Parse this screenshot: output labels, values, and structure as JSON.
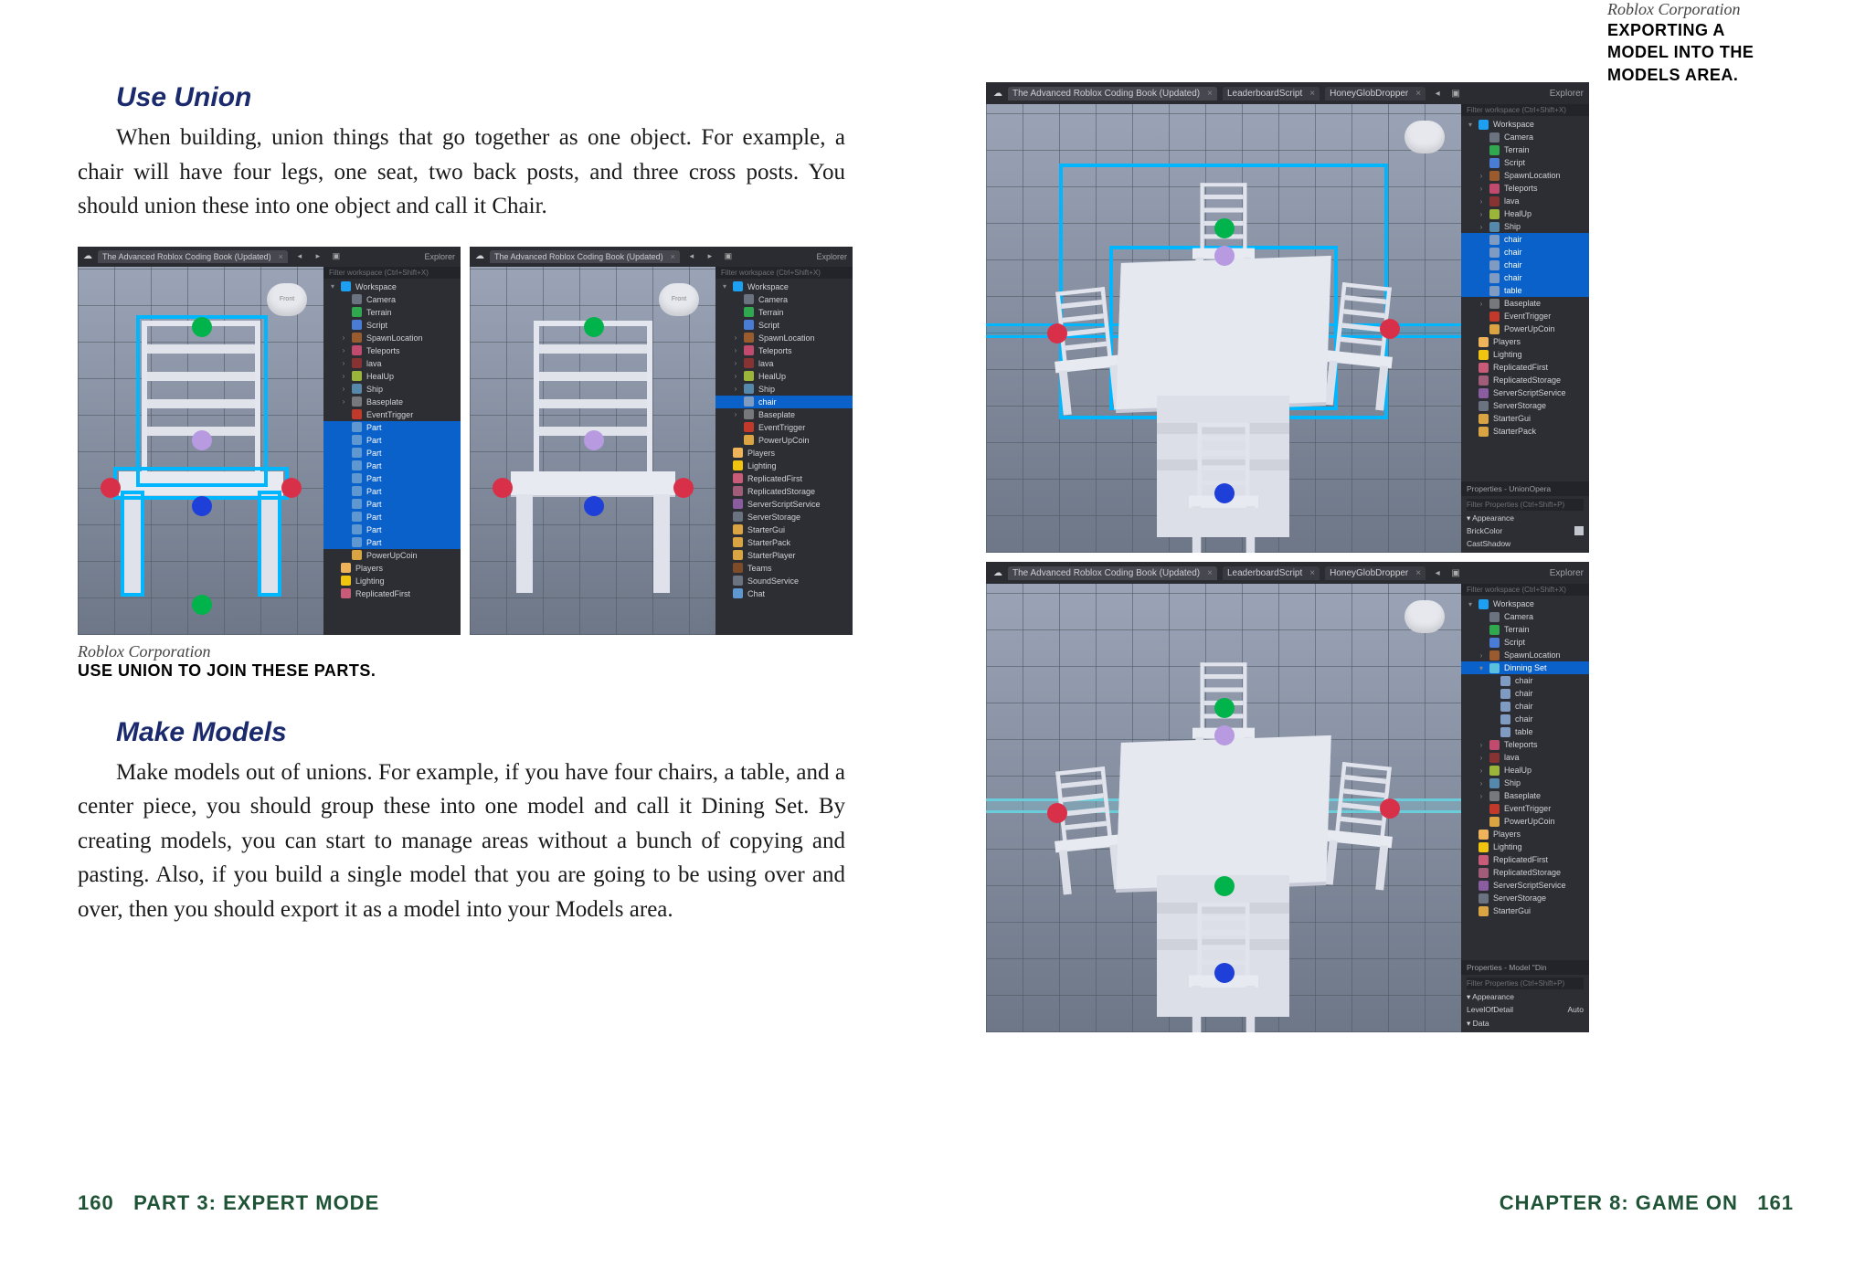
{
  "leftPage": {
    "heading1": "Use Union",
    "para1": "When building, union things that go together as one object. For example, a chair will have four legs, one seat, two back posts, and three cross posts. You should union these into one object and call it Chair.",
    "figCredit": "Roblox Corporation",
    "figCaption": "USE UNION TO JOIN THESE PARTS.",
    "heading2": "Make Models",
    "para2": "Make models out of unions. For example, if you have four chairs, a table, and a center piece, you should group these into one model and call it Dining Set. By creating models, you can start to manage areas without a bunch of copying and pasting. Also, if you build a single model that you are going to be using over and over, then you should export it as a model into your Models area.",
    "footerNum": "160",
    "footerText": "PART 3: EXPERT MODE"
  },
  "rightPage": {
    "figCredit": "Roblox Corporation",
    "figCaption": "EXPORTING A MODEL INTO THE MODELS AREA.",
    "footerText": "CHAPTER 8: GAME ON",
    "footerNum": "161"
  },
  "studio": {
    "tabMain": "The Advanced Roblox Coding Book (Updated)",
    "tabLeaderboard": "LeaderboardScript",
    "tabHoney": "HoneyGlobDropper",
    "explorer": "Explorer",
    "filterWorkspace": "Filter workspace (Ctrl+Shift+X)",
    "filterProps": "Filter Properties (Ctrl+Shift+P)",
    "propsUnion": "Properties - UnionOpera",
    "propsModel": "Properties - Model \"Din",
    "appearance": "Appearance",
    "brickColor": "BrickColor",
    "castShadow": "CastShadow",
    "levelOfDetail": "LevelOfDetail",
    "levelOfDetailVal": "Auto",
    "dataSect": "Data",
    "puck": "Front"
  },
  "treeA": {
    "items": [
      {
        "ind": 0,
        "ar": "▾",
        "ic": "i-ws",
        "t": "Workspace"
      },
      {
        "ind": 1,
        "ar": "",
        "ic": "i-cam",
        "t": "Camera"
      },
      {
        "ind": 1,
        "ar": "",
        "ic": "i-ter",
        "t": "Terrain"
      },
      {
        "ind": 1,
        "ar": "",
        "ic": "i-scr",
        "t": "Script"
      },
      {
        "ind": 1,
        "ar": "›",
        "ic": "i-spawn",
        "t": "SpawnLocation"
      },
      {
        "ind": 1,
        "ar": "›",
        "ic": "i-tele",
        "t": "Teleports"
      },
      {
        "ind": 1,
        "ar": "›",
        "ic": "i-lava",
        "t": "lava"
      },
      {
        "ind": 1,
        "ar": "›",
        "ic": "i-heal",
        "t": "HealUp"
      },
      {
        "ind": 1,
        "ar": "›",
        "ic": "i-ship",
        "t": "Ship"
      },
      {
        "ind": 1,
        "ar": "›",
        "ic": "i-base",
        "t": "Baseplate"
      },
      {
        "ind": 1,
        "ar": "",
        "ic": "i-ev",
        "t": "EventTrigger"
      },
      {
        "ind": 1,
        "ar": "",
        "ic": "i-part",
        "t": "Part",
        "sel": true
      },
      {
        "ind": 1,
        "ar": "",
        "ic": "i-part",
        "t": "Part",
        "sel": true
      },
      {
        "ind": 1,
        "ar": "",
        "ic": "i-part",
        "t": "Part",
        "sel": true
      },
      {
        "ind": 1,
        "ar": "",
        "ic": "i-part",
        "t": "Part",
        "sel": true
      },
      {
        "ind": 1,
        "ar": "",
        "ic": "i-part",
        "t": "Part",
        "sel": true
      },
      {
        "ind": 1,
        "ar": "",
        "ic": "i-part",
        "t": "Part",
        "sel": true
      },
      {
        "ind": 1,
        "ar": "",
        "ic": "i-part",
        "t": "Part",
        "sel": true
      },
      {
        "ind": 1,
        "ar": "",
        "ic": "i-part",
        "t": "Part",
        "sel": true
      },
      {
        "ind": 1,
        "ar": "",
        "ic": "i-part",
        "t": "Part",
        "sel": true
      },
      {
        "ind": 1,
        "ar": "",
        "ic": "i-part",
        "t": "Part",
        "sel": true
      },
      {
        "ind": 1,
        "ar": "",
        "ic": "i-coin",
        "t": "PowerUpCoin"
      },
      {
        "ind": 0,
        "ar": "",
        "ic": "i-ply",
        "t": "Players"
      },
      {
        "ind": 0,
        "ar": "",
        "ic": "i-lgt",
        "t": "Lighting"
      },
      {
        "ind": 0,
        "ar": "",
        "ic": "i-rep",
        "t": "ReplicatedFirst"
      }
    ]
  },
  "treeB": {
    "items": [
      {
        "ind": 0,
        "ar": "▾",
        "ic": "i-ws",
        "t": "Workspace"
      },
      {
        "ind": 1,
        "ar": "",
        "ic": "i-cam",
        "t": "Camera"
      },
      {
        "ind": 1,
        "ar": "",
        "ic": "i-ter",
        "t": "Terrain"
      },
      {
        "ind": 1,
        "ar": "",
        "ic": "i-scr",
        "t": "Script"
      },
      {
        "ind": 1,
        "ar": "›",
        "ic": "i-spawn",
        "t": "SpawnLocation"
      },
      {
        "ind": 1,
        "ar": "›",
        "ic": "i-tele",
        "t": "Teleports"
      },
      {
        "ind": 1,
        "ar": "›",
        "ic": "i-lava",
        "t": "lava"
      },
      {
        "ind": 1,
        "ar": "›",
        "ic": "i-heal",
        "t": "HealUp"
      },
      {
        "ind": 1,
        "ar": "›",
        "ic": "i-ship",
        "t": "Ship"
      },
      {
        "ind": 1,
        "ar": "",
        "ic": "i-cube",
        "t": "chair",
        "sel": true
      },
      {
        "ind": 1,
        "ar": "›",
        "ic": "i-base",
        "t": "Baseplate"
      },
      {
        "ind": 1,
        "ar": "",
        "ic": "i-ev",
        "t": "EventTrigger"
      },
      {
        "ind": 1,
        "ar": "",
        "ic": "i-coin",
        "t": "PowerUpCoin"
      },
      {
        "ind": 0,
        "ar": "",
        "ic": "i-ply",
        "t": "Players"
      },
      {
        "ind": 0,
        "ar": "",
        "ic": "i-lgt",
        "t": "Lighting"
      },
      {
        "ind": 0,
        "ar": "",
        "ic": "i-rep",
        "t": "ReplicatedFirst"
      },
      {
        "ind": 0,
        "ar": "",
        "ic": "i-rst",
        "t": "ReplicatedStorage"
      },
      {
        "ind": 0,
        "ar": "",
        "ic": "i-sss",
        "t": "ServerScriptService"
      },
      {
        "ind": 0,
        "ar": "",
        "ic": "i-ss",
        "t": "ServerStorage"
      },
      {
        "ind": 0,
        "ar": "",
        "ic": "i-sg",
        "t": "StarterGui"
      },
      {
        "ind": 0,
        "ar": "",
        "ic": "i-sp",
        "t": "StarterPack"
      },
      {
        "ind": 0,
        "ar": "",
        "ic": "i-sp",
        "t": "StarterPlayer"
      },
      {
        "ind": 0,
        "ar": "",
        "ic": "i-tm",
        "t": "Teams"
      },
      {
        "ind": 0,
        "ar": "",
        "ic": "i-snd",
        "t": "SoundService"
      },
      {
        "ind": 0,
        "ar": "",
        "ic": "i-chat",
        "t": "Chat"
      }
    ]
  },
  "treeC": {
    "items": [
      {
        "ind": 0,
        "ar": "▾",
        "ic": "i-ws",
        "t": "Workspace"
      },
      {
        "ind": 1,
        "ar": "",
        "ic": "i-cam",
        "t": "Camera"
      },
      {
        "ind": 1,
        "ar": "",
        "ic": "i-ter",
        "t": "Terrain"
      },
      {
        "ind": 1,
        "ar": "",
        "ic": "i-scr",
        "t": "Script"
      },
      {
        "ind": 1,
        "ar": "›",
        "ic": "i-spawn",
        "t": "SpawnLocation"
      },
      {
        "ind": 1,
        "ar": "›",
        "ic": "i-tele",
        "t": "Teleports"
      },
      {
        "ind": 1,
        "ar": "›",
        "ic": "i-lava",
        "t": "lava"
      },
      {
        "ind": 1,
        "ar": "›",
        "ic": "i-heal",
        "t": "HealUp"
      },
      {
        "ind": 1,
        "ar": "›",
        "ic": "i-ship",
        "t": "Ship"
      },
      {
        "ind": 1,
        "ar": "",
        "ic": "i-cube",
        "t": "chair",
        "sel": true
      },
      {
        "ind": 1,
        "ar": "",
        "ic": "i-cube",
        "t": "chair",
        "sel": true
      },
      {
        "ind": 1,
        "ar": "",
        "ic": "i-cube",
        "t": "chair",
        "sel": true
      },
      {
        "ind": 1,
        "ar": "",
        "ic": "i-cube",
        "t": "chair",
        "sel": true
      },
      {
        "ind": 1,
        "ar": "",
        "ic": "i-cube",
        "t": "table",
        "sel": true
      },
      {
        "ind": 1,
        "ar": "›",
        "ic": "i-base",
        "t": "Baseplate"
      },
      {
        "ind": 1,
        "ar": "",
        "ic": "i-ev",
        "t": "EventTrigger"
      },
      {
        "ind": 1,
        "ar": "",
        "ic": "i-coin",
        "t": "PowerUpCoin"
      },
      {
        "ind": 0,
        "ar": "",
        "ic": "i-ply",
        "t": "Players"
      },
      {
        "ind": 0,
        "ar": "",
        "ic": "i-lgt",
        "t": "Lighting"
      },
      {
        "ind": 0,
        "ar": "",
        "ic": "i-rep",
        "t": "ReplicatedFirst"
      },
      {
        "ind": 0,
        "ar": "",
        "ic": "i-rst",
        "t": "ReplicatedStorage"
      },
      {
        "ind": 0,
        "ar": "",
        "ic": "i-sss",
        "t": "ServerScriptService"
      },
      {
        "ind": 0,
        "ar": "",
        "ic": "i-ss",
        "t": "ServerStorage"
      },
      {
        "ind": 0,
        "ar": "",
        "ic": "i-sg",
        "t": "StarterGui"
      },
      {
        "ind": 0,
        "ar": "",
        "ic": "i-sp",
        "t": "StarterPack"
      }
    ]
  },
  "treeD": {
    "items": [
      {
        "ind": 0,
        "ar": "▾",
        "ic": "i-ws",
        "t": "Workspace"
      },
      {
        "ind": 1,
        "ar": "",
        "ic": "i-cam",
        "t": "Camera"
      },
      {
        "ind": 1,
        "ar": "",
        "ic": "i-ter",
        "t": "Terrain"
      },
      {
        "ind": 1,
        "ar": "",
        "ic": "i-scr",
        "t": "Script"
      },
      {
        "ind": 1,
        "ar": "›",
        "ic": "i-spawn",
        "t": "SpawnLocation"
      },
      {
        "ind": 1,
        "ar": "▾",
        "ic": "i-mdl",
        "t": "Dinning Set",
        "sel": true
      },
      {
        "ind": 2,
        "ar": "",
        "ic": "i-cube",
        "t": "chair"
      },
      {
        "ind": 2,
        "ar": "",
        "ic": "i-cube",
        "t": "chair"
      },
      {
        "ind": 2,
        "ar": "",
        "ic": "i-cube",
        "t": "chair"
      },
      {
        "ind": 2,
        "ar": "",
        "ic": "i-cube",
        "t": "chair"
      },
      {
        "ind": 2,
        "ar": "",
        "ic": "i-cube",
        "t": "table"
      },
      {
        "ind": 1,
        "ar": "›",
        "ic": "i-tele",
        "t": "Teleports"
      },
      {
        "ind": 1,
        "ar": "›",
        "ic": "i-lava",
        "t": "lava"
      },
      {
        "ind": 1,
        "ar": "›",
        "ic": "i-heal",
        "t": "HealUp"
      },
      {
        "ind": 1,
        "ar": "›",
        "ic": "i-ship",
        "t": "Ship"
      },
      {
        "ind": 1,
        "ar": "›",
        "ic": "i-base",
        "t": "Baseplate"
      },
      {
        "ind": 1,
        "ar": "",
        "ic": "i-ev",
        "t": "EventTrigger"
      },
      {
        "ind": 1,
        "ar": "",
        "ic": "i-coin",
        "t": "PowerUpCoin"
      },
      {
        "ind": 0,
        "ar": "",
        "ic": "i-ply",
        "t": "Players"
      },
      {
        "ind": 0,
        "ar": "",
        "ic": "i-lgt",
        "t": "Lighting"
      },
      {
        "ind": 0,
        "ar": "",
        "ic": "i-rep",
        "t": "ReplicatedFirst"
      },
      {
        "ind": 0,
        "ar": "",
        "ic": "i-rst",
        "t": "ReplicatedStorage"
      },
      {
        "ind": 0,
        "ar": "",
        "ic": "i-sss",
        "t": "ServerScriptService"
      },
      {
        "ind": 0,
        "ar": "",
        "ic": "i-ss",
        "t": "ServerStorage"
      },
      {
        "ind": 0,
        "ar": "",
        "ic": "i-sg",
        "t": "StarterGui"
      }
    ]
  }
}
